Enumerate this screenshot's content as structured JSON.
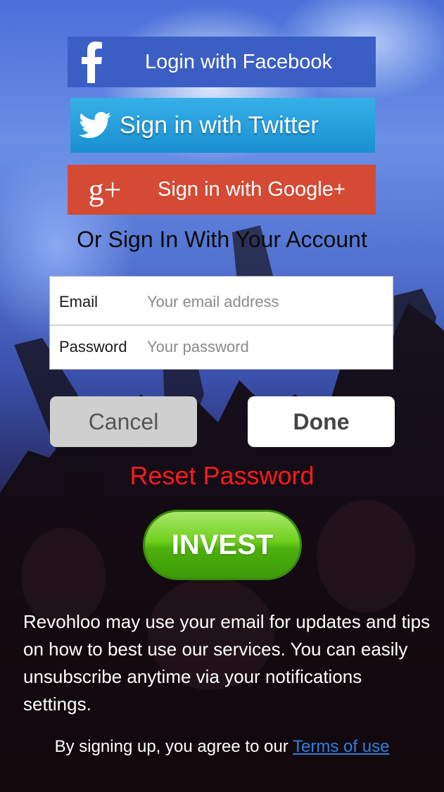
{
  "social": {
    "facebook_label": "Login with Facebook",
    "twitter_label": "Sign in with Twitter",
    "google_label": "Sign in with Google+",
    "google_glyph": "g+",
    "facebook_glyph": "f"
  },
  "or_text": "Or Sign In With Your Account",
  "form": {
    "email_label": "Email",
    "email_placeholder": "Your email address",
    "password_label": "Password",
    "password_placeholder": "Your password"
  },
  "buttons": {
    "cancel": "Cancel",
    "done": "Done",
    "reset_password": "Reset Password",
    "invest": "INVEST"
  },
  "notice": "Revohloo may use your email for updates and tips on how to best use our services. You can easily unsubscribe anytime via your notifications settings.",
  "terms": {
    "prefix": "By signing up, you agree to our ",
    "link": "Terms of use"
  },
  "colors": {
    "facebook": "#3b5ec4",
    "twitter": "#1a9ad8",
    "google": "#d44a35",
    "reset": "#ff1a1a",
    "invest": "#5cc016"
  }
}
